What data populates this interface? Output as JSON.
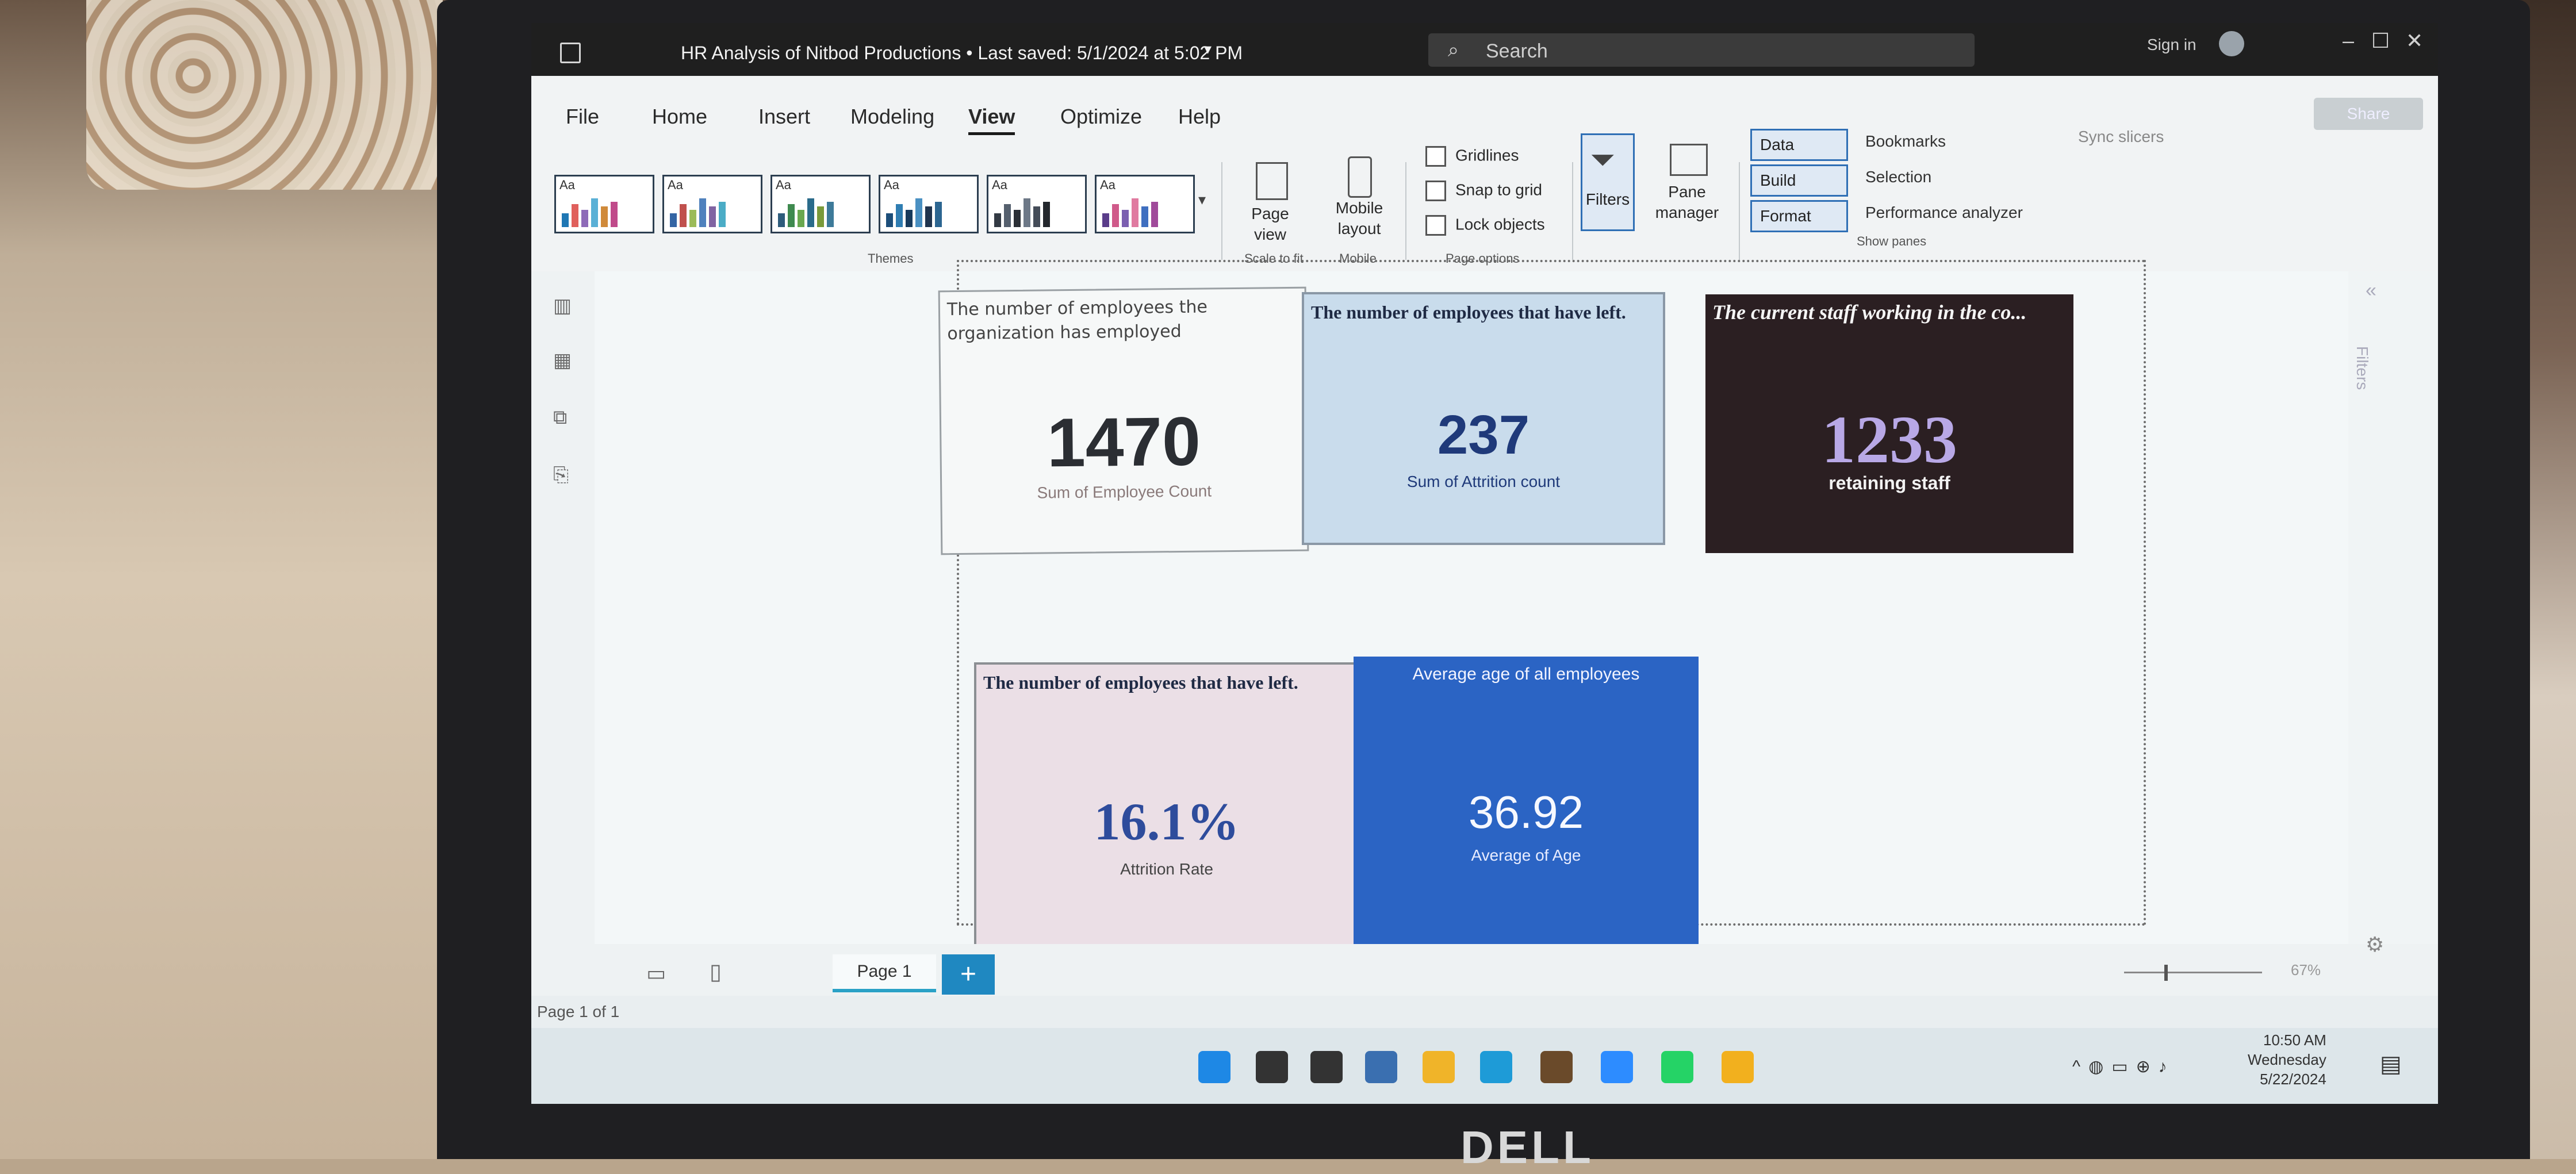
{
  "window": {
    "title": "HR Analysis of Nitbod Productions",
    "separator": "•",
    "last_saved": "Last saved: 5/1/2024 at 5:02 PM",
    "search_placeholder": "Search",
    "sign_in": "Sign in",
    "share": "Share"
  },
  "menu": {
    "items": [
      "File",
      "Home",
      "Insert",
      "Modeling",
      "View",
      "Optimize",
      "Help"
    ],
    "active": "View"
  },
  "ribbon": {
    "themes_label": "Themes",
    "theme_tile_text": "Aa",
    "page_view": "Page view",
    "scale_to_fit": "Scale to fit",
    "mobile_layout": "Mobile layout",
    "mobile_group": "Mobile",
    "page_options": {
      "gridlines": "Gridlines",
      "snap_to_grid": "Snap to grid",
      "lock_objects": "Lock objects",
      "group_label": "Page options"
    },
    "filters": "Filters",
    "pane_manager": "Pane manager",
    "show_panes": {
      "data": "Data",
      "build": "Build",
      "format": "Format",
      "bookmarks": "Bookmarks",
      "selection": "Selection",
      "performance_analyzer": "Performance analyzer",
      "sync_slicers": "Sync slicers",
      "group_label": "Show panes"
    },
    "theme_colors": [
      [
        "#1f77b4",
        "#e0605c",
        "#8e6bb8",
        "#5ab0d6",
        "#d08a3a",
        "#c04a8a"
      ],
      [
        "#3465a4",
        "#c0504d",
        "#9bbb59",
        "#4f81bd",
        "#8064a2",
        "#4bacc6"
      ],
      [
        "#2e5c7c",
        "#3f8a4f",
        "#6aa84f",
        "#2a6b8a",
        "#7a9a3a",
        "#3d7a99"
      ],
      [
        "#1c4e7a",
        "#2f7db2",
        "#173a5c",
        "#4a90c2",
        "#20344e",
        "#2c6691"
      ],
      [
        "#333a44",
        "#55606e",
        "#2b2f36",
        "#6d7887",
        "#444c58",
        "#23272d"
      ],
      [
        "#5a3d8a",
        "#d05a8a",
        "#7b5fb0",
        "#e07aa0",
        "#3f6fc0",
        "#a04a9a"
      ]
    ]
  },
  "cards": {
    "employed": {
      "title": "The number of employees the organization has employed",
      "value": "1470",
      "subtitle": "Sum of Employee Count"
    },
    "left": {
      "title": "The number of employees that have left.",
      "value": "237",
      "subtitle": "Sum of Attrition count"
    },
    "staff": {
      "title": "The current staff working in the co...",
      "value": "1233",
      "subtitle": "retaining staff"
    },
    "rate": {
      "title": "The number of employees that have left.",
      "value": "16.1%",
      "subtitle": "Attrition Rate"
    },
    "age": {
      "title": "Average age of all employees",
      "value": "36.92",
      "subtitle": "Average of Age"
    }
  },
  "filters_pane": {
    "label": "Filters"
  },
  "pages": {
    "tab": "Page 1",
    "add": "+",
    "status": "Page 1 of 1",
    "zoom": "67%"
  },
  "taskbar": {
    "time": "10:50 AM",
    "day": "Wednesday",
    "date": "5/22/2024",
    "app_colors": [
      "#1e88e5",
      "#333333",
      "#333333",
      "#3a6fb0",
      "#f0b429",
      "#1e9bd7",
      "#6a4a2a",
      "#2d8cff",
      "#25d366",
      "#f2b01e"
    ]
  },
  "brand": "DELL"
}
